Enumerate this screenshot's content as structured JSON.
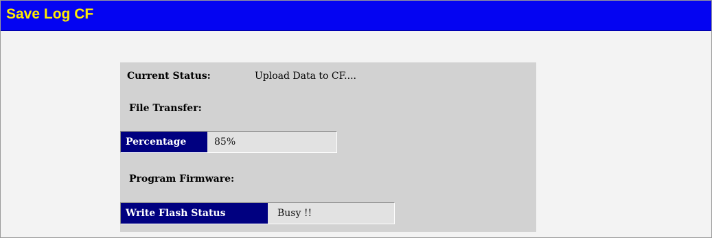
{
  "window": {
    "title": "Save Log CF"
  },
  "status": {
    "label": "Current Status:",
    "value": "Upload Data to CF...."
  },
  "file_transfer": {
    "heading": "File Transfer:",
    "percentage_label": "Percentage",
    "percentage_value": "85%"
  },
  "program_firmware": {
    "heading": "Program Firmware:",
    "write_flash_label": "Write Flash Status",
    "write_flash_value": "Busy !!"
  },
  "colors": {
    "title_bar": "#0404f2",
    "title_text": "#ffec00",
    "label_bg": "#000080",
    "panel_bg": "#d2d2d2"
  }
}
